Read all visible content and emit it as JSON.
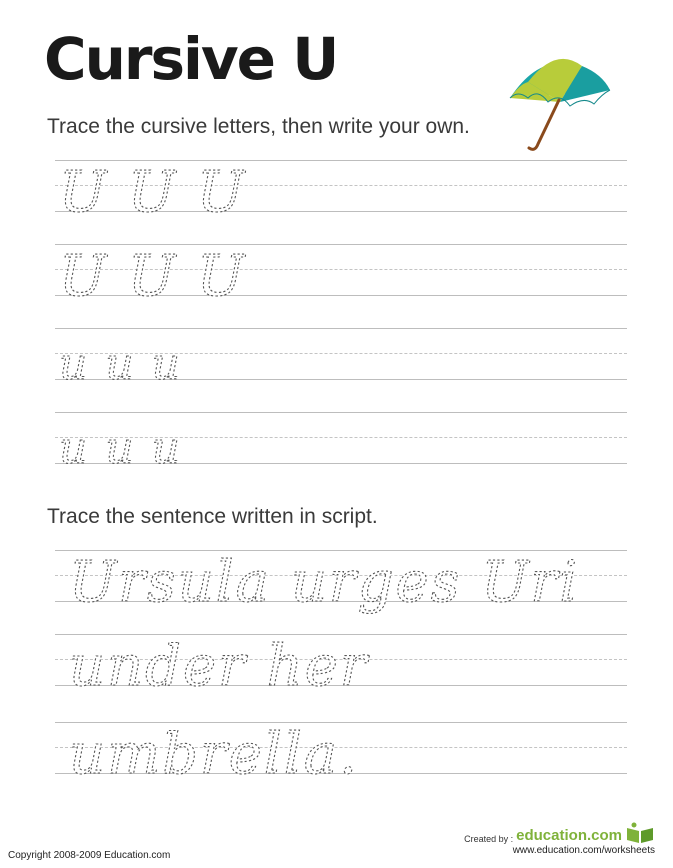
{
  "title": "Cursive U",
  "instructions": {
    "letters": "Trace the cursive letters, then write your own.",
    "sentence": "Trace the sentence written in script."
  },
  "practice_rows": [
    {
      "text": "U U U"
    },
    {
      "text": "U U U"
    },
    {
      "text": "u u u"
    },
    {
      "text": "u u u"
    }
  ],
  "sentence_rows": [
    {
      "text": "Ursula urges Uri"
    },
    {
      "text": "under her"
    },
    {
      "text": "umbrella."
    }
  ],
  "illustration": {
    "icon": "umbrella-icon",
    "colors": [
      "#1aa6a8",
      "#b8cc3a",
      "#8a4a1c"
    ]
  },
  "footer": {
    "copyright": "Copyright 2008-2009 Education.com",
    "created_by": "Created by :",
    "brand": "education.com",
    "url": "www.education.com/worksheets"
  },
  "colors": {
    "brand_green": "#7fb23a",
    "rule_gray": "#bdbdbd",
    "trace_gray": "#555555"
  }
}
